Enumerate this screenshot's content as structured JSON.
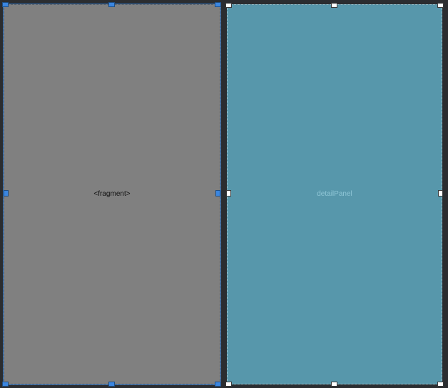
{
  "fragment_panel": {
    "label": "<fragment>",
    "selected": true
  },
  "detail_panel": {
    "label": "detailPanel",
    "selected": false
  },
  "colors": {
    "background": "#2b2d30",
    "fragment_fill": "#808080",
    "detail_fill": "#5797ab",
    "selection_handle": "#3b86e0",
    "unselected_handle": "#ffffff"
  }
}
